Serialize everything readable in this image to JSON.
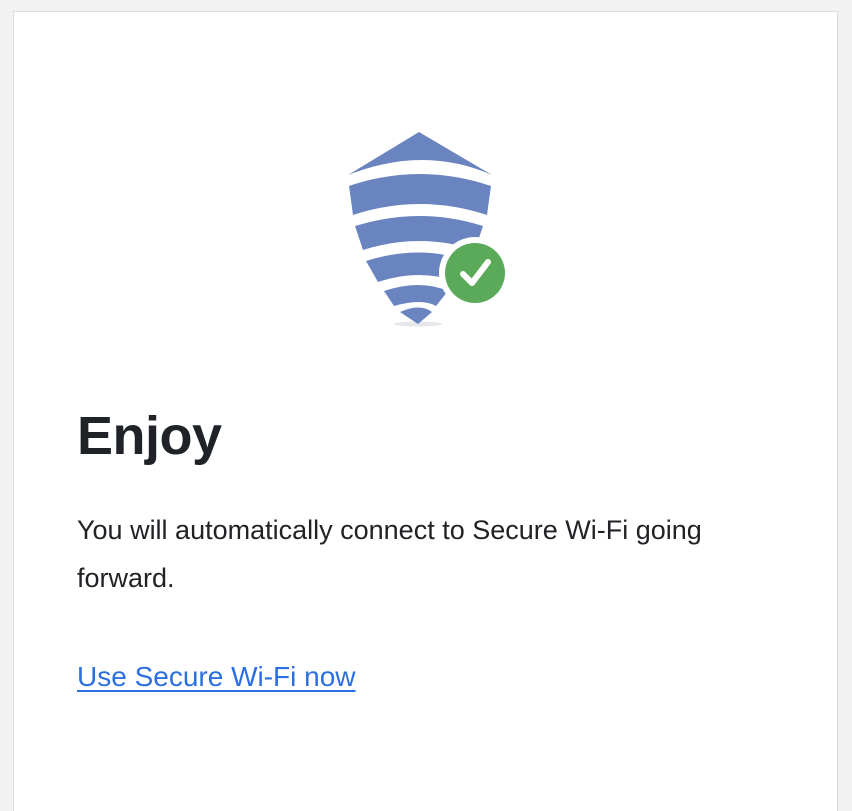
{
  "card": {
    "illustration": {
      "icon": "shield-with-checkmark-icon",
      "shield_color": "#6a84c0",
      "check_badge_color": "#5aaa5a"
    },
    "title": "Enjoy",
    "message": "You will automatically connect to Secure Wi-Fi going forward.",
    "link_label": "Use Secure Wi-Fi now",
    "link_color": "#2b6fe0"
  }
}
